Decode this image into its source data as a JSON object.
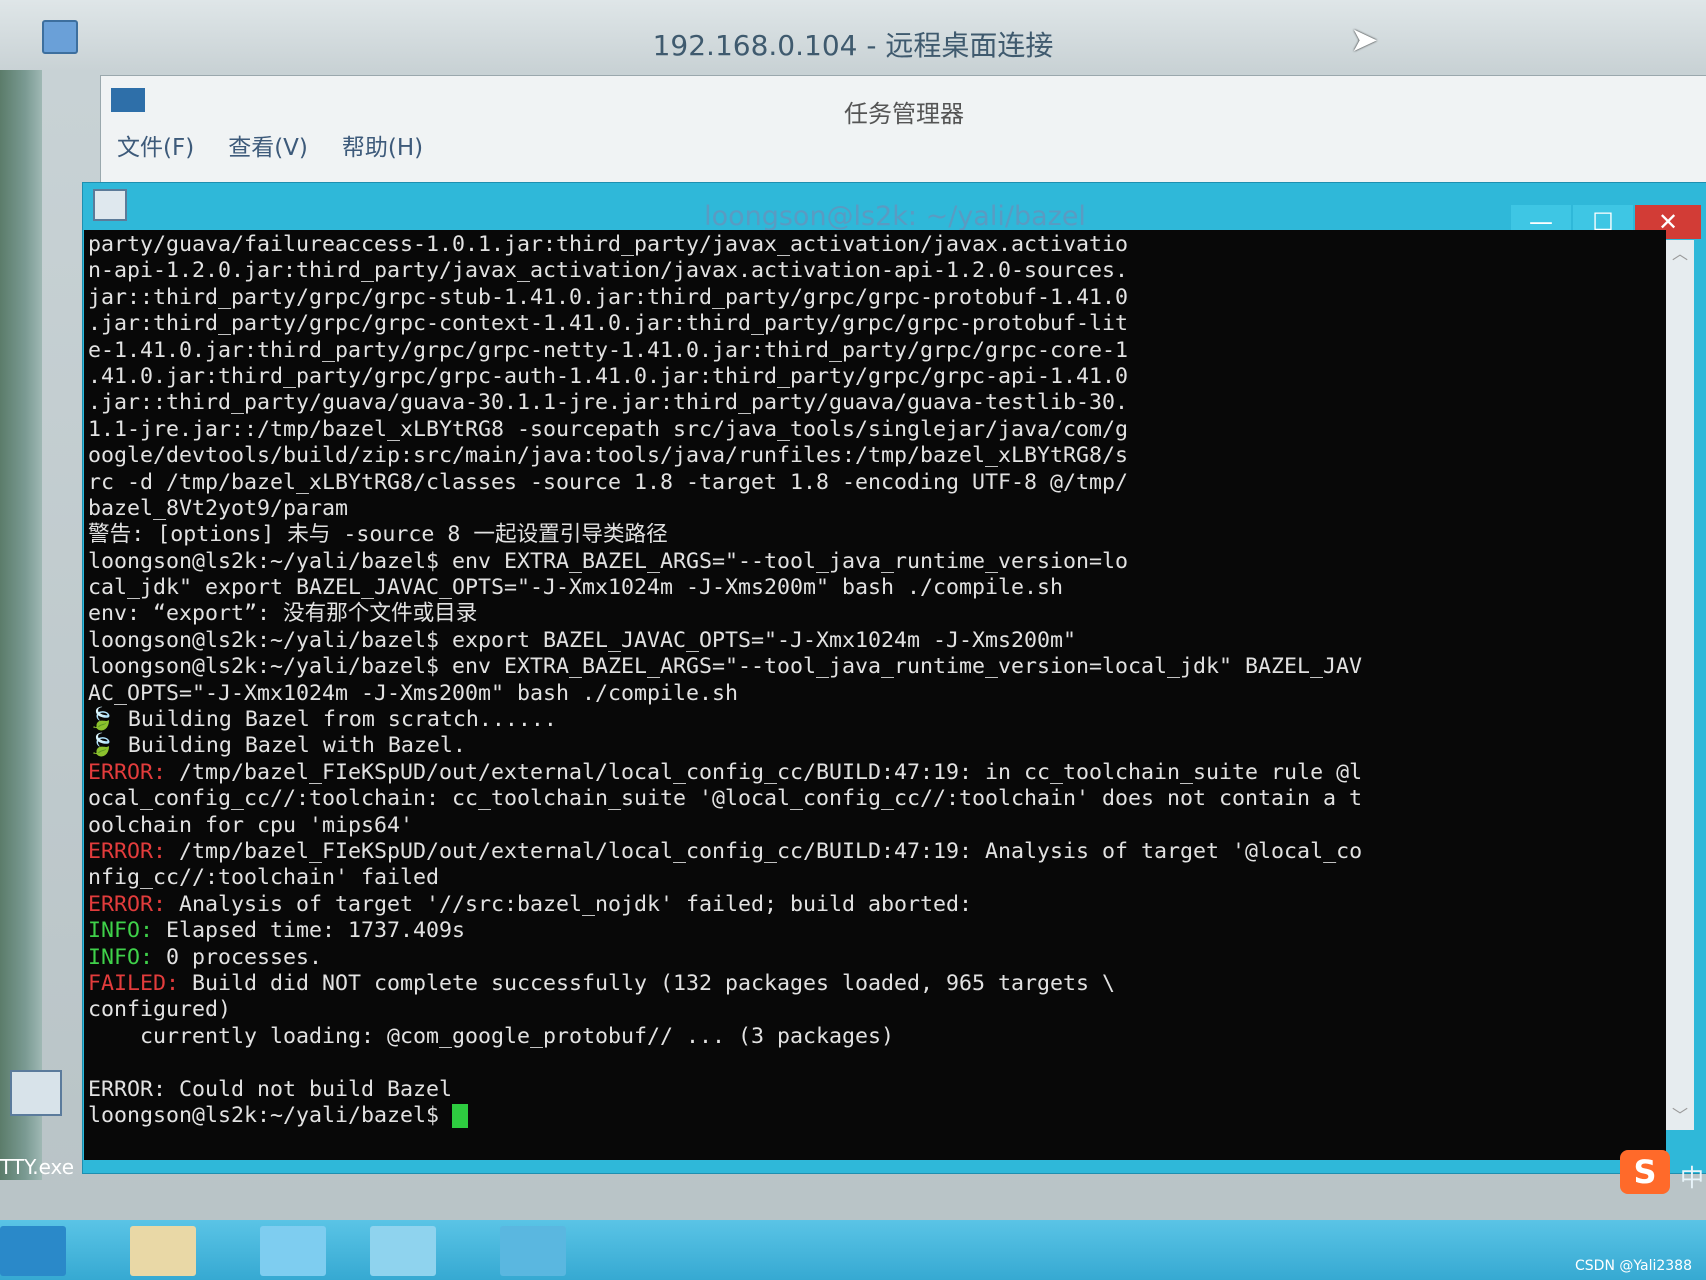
{
  "rdp": {
    "title": "192.168.0.104 - 远程桌面连接"
  },
  "task_manager": {
    "title": "任务管理器",
    "menu": [
      "文件(F)",
      "查看(V)",
      "帮助(H)"
    ]
  },
  "putty": {
    "title": "loongson@ls2k: ~/yali/bazel",
    "controls": {
      "minimize": "—",
      "maximize": "☐",
      "close": "✕"
    }
  },
  "terminal": {
    "lines": [
      {
        "label": "",
        "text": "party/guava/failureaccess-1.0.1.jar:third_party/javax_activation/javax.activatio"
      },
      {
        "label": "",
        "text": "n-api-1.2.0.jar:third_party/javax_activation/javax.activation-api-1.2.0-sources."
      },
      {
        "label": "",
        "text": "jar::third_party/grpc/grpc-stub-1.41.0.jar:third_party/grpc/grpc-protobuf-1.41.0"
      },
      {
        "label": "",
        "text": ".jar:third_party/grpc/grpc-context-1.41.0.jar:third_party/grpc/grpc-protobuf-lit"
      },
      {
        "label": "",
        "text": "e-1.41.0.jar:third_party/grpc/grpc-netty-1.41.0.jar:third_party/grpc/grpc-core-1"
      },
      {
        "label": "",
        "text": ".41.0.jar:third_party/grpc/grpc-auth-1.41.0.jar:third_party/grpc/grpc-api-1.41.0"
      },
      {
        "label": "",
        "text": ".jar::third_party/guava/guava-30.1.1-jre.jar:third_party/guava/guava-testlib-30."
      },
      {
        "label": "",
        "text": "1.1-jre.jar::/tmp/bazel_xLBYtRG8 -sourcepath src/java_tools/singlejar/java/com/g"
      },
      {
        "label": "",
        "text": "oogle/devtools/build/zip:src/main/java:tools/java/runfiles:/tmp/bazel_xLBYtRG8/s"
      },
      {
        "label": "",
        "text": "rc -d /tmp/bazel_xLBYtRG8/classes -source 1.8 -target 1.8 -encoding UTF-8 @/tmp/"
      },
      {
        "label": "",
        "text": "bazel_8Vt2yot9/param"
      },
      {
        "label": "",
        "text": "警告: [options] 未与 -source 8 一起设置引导类路径"
      },
      {
        "label": "",
        "text": "loongson@ls2k:~/yali/bazel$ env EXTRA_BAZEL_ARGS=\"--tool_java_runtime_version=lo"
      },
      {
        "label": "",
        "text": "cal_jdk\" export BAZEL_JAVAC_OPTS=\"-J-Xmx1024m -J-Xms200m\" bash ./compile.sh"
      },
      {
        "label": "",
        "text": "env: “export”: 没有那个文件或目录"
      },
      {
        "label": "",
        "text": "loongson@ls2k:~/yali/bazel$ export BAZEL_JAVAC_OPTS=\"-J-Xmx1024m -J-Xms200m\""
      },
      {
        "label": "",
        "text": "loongson@ls2k:~/yali/bazel$ env EXTRA_BAZEL_ARGS=\"--tool_java_runtime_version=local_jdk\" BAZEL_JAV"
      },
      {
        "label": "",
        "text": "AC_OPTS=\"-J-Xmx1024m -J-Xms200m\" bash ./compile.sh"
      },
      {
        "label": "",
        "text": "🍃 Building Bazel from scratch......"
      },
      {
        "label": "",
        "text": "🍃 Building Bazel with Bazel."
      },
      {
        "label": "ERROR:",
        "text": " /tmp/bazel_FIeKSpUD/out/external/local_config_cc/BUILD:47:19: in cc_toolchain_suite rule @l"
      },
      {
        "label": "",
        "text": "ocal_config_cc//:toolchain: cc_toolchain_suite '@local_config_cc//:toolchain' does not contain a t"
      },
      {
        "label": "",
        "text": "oolchain for cpu 'mips64'"
      },
      {
        "label": "ERROR:",
        "text": " /tmp/bazel_FIeKSpUD/out/external/local_config_cc/BUILD:47:19: Analysis of target '@local_co"
      },
      {
        "label": "",
        "text": "nfig_cc//:toolchain' failed"
      },
      {
        "label": "ERROR:",
        "text": " Analysis of target '//src:bazel_nojdk' failed; build aborted:"
      },
      {
        "label": "INFO:",
        "text": " Elapsed time: 1737.409s"
      },
      {
        "label": "INFO:",
        "text": " 0 processes."
      },
      {
        "label": "FAILED:",
        "text": " Build did NOT complete successfully (132 packages loaded, 965 targets \\"
      },
      {
        "label": "",
        "text": "configured)"
      },
      {
        "label": "",
        "text": "    currently loading: @com_google_protobuf// ... (3 packages)"
      },
      {
        "label": "",
        "text": ""
      },
      {
        "label": "",
        "text": "ERROR: Could not build Bazel"
      }
    ],
    "prompt": "loongson@ls2k:~/yali/bazel$ "
  },
  "desktop": {
    "putty_label": "TTY.exe"
  },
  "tray": {
    "ime": "中",
    "ime_logo": "S"
  },
  "watermark": "CSDN @Yali2388",
  "colors": {
    "error": "#e23c3c",
    "info": "#3fd14a",
    "cursor": "#2ecc40",
    "close": "#d23c36"
  }
}
